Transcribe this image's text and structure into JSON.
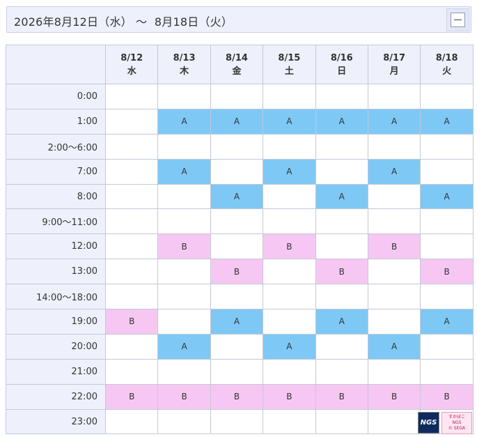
{
  "header": {
    "title": "2026年8月12日（水） ～  8月18日（火）"
  },
  "table": {
    "days": [
      {
        "date": "8/12",
        "weekday": "水"
      },
      {
        "date": "8/13",
        "weekday": "木"
      },
      {
        "date": "8/14",
        "weekday": "金"
      },
      {
        "date": "8/15",
        "weekday": "土"
      },
      {
        "date": "8/16",
        "weekday": "日"
      },
      {
        "date": "8/17",
        "weekday": "月"
      },
      {
        "date": "8/18",
        "weekday": "火"
      }
    ],
    "rows": [
      {
        "time": "0:00",
        "cells": [
          "",
          "",
          "",
          "",
          "",
          "",
          ""
        ]
      },
      {
        "time": "1:00",
        "cells": [
          "",
          "A",
          "A",
          "A",
          "A",
          "A",
          "A"
        ]
      },
      {
        "time": "2:00～6:00",
        "cells": [
          "",
          "",
          "",
          "",
          "",
          "",
          ""
        ]
      },
      {
        "time": "7:00",
        "cells": [
          "",
          "A",
          "",
          "A",
          "",
          "A",
          ""
        ]
      },
      {
        "time": "8:00",
        "cells": [
          "",
          "",
          "A",
          "",
          "A",
          "",
          "A"
        ]
      },
      {
        "time": "9:00～11:00",
        "cells": [
          "",
          "",
          "",
          "",
          "",
          "",
          ""
        ]
      },
      {
        "time": "12:00",
        "cells": [
          "",
          "B",
          "",
          "B",
          "",
          "B",
          ""
        ]
      },
      {
        "time": "13:00",
        "cells": [
          "",
          "",
          "B",
          "",
          "B",
          "",
          "B"
        ]
      },
      {
        "time": "14:00～18:00",
        "cells": [
          "",
          "",
          "",
          "",
          "",
          "",
          ""
        ]
      },
      {
        "time": "19:00",
        "cells": [
          "B",
          "",
          "A",
          "",
          "A",
          "",
          "A"
        ]
      },
      {
        "time": "20:00",
        "cells": [
          "",
          "A",
          "",
          "A",
          "",
          "A",
          ""
        ]
      },
      {
        "time": "21:00",
        "cells": [
          "",
          "",
          "",
          "",
          "",
          "",
          ""
        ]
      },
      {
        "time": "22:00",
        "cells": [
          "B",
          "B",
          "B",
          "B",
          "B",
          "B",
          "B"
        ]
      },
      {
        "time": "23:00",
        "cells": [
          "",
          "",
          "",
          "",
          "",
          "",
          ""
        ]
      }
    ]
  },
  "colors": {
    "A": "#7ec8f5",
    "B": "#f7c7f3",
    "header_bg": "#eef1fb",
    "border": "#c3c8d6"
  },
  "badges": {
    "ngs_label": "NGS",
    "promo_lines": [
      "すかぼこ",
      "NGS",
      "© SEGA"
    ]
  },
  "icons": {
    "collapse": "minus-square-icon"
  }
}
